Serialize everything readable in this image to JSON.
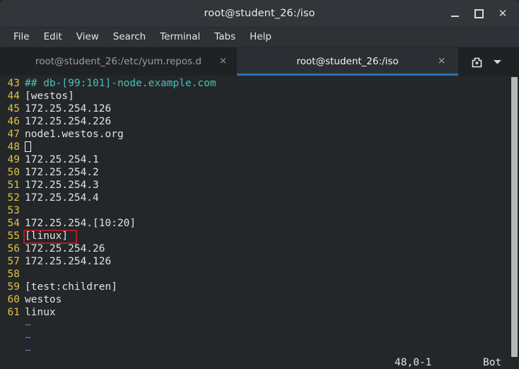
{
  "window": {
    "title": "root@student_26:/iso",
    "controls": {
      "minimize": "minimize-icon",
      "maximize": "maximize-icon",
      "close": "✕"
    }
  },
  "menubar": {
    "items": [
      {
        "label": "File"
      },
      {
        "label": "Edit"
      },
      {
        "label": "View"
      },
      {
        "label": "Search"
      },
      {
        "label": "Terminal"
      },
      {
        "label": "Tabs"
      },
      {
        "label": "Help"
      }
    ]
  },
  "tabs": {
    "items": [
      {
        "label": "root@student_26:/etc/yum.repos.d",
        "close": "✕",
        "active": false
      },
      {
        "label": "root@student_26:/iso",
        "close": "✕",
        "active": true
      }
    ],
    "new_tab_icon": "new-tab-icon",
    "tab_menu_icon": "chevron-down-icon",
    "active_indicator_color": "#2a70b8"
  },
  "editor": {
    "lines": [
      {
        "no": "43",
        "text": "## db-[99:101]-node.example.com",
        "style": "comment"
      },
      {
        "no": "44",
        "text": "[westos]",
        "style": "normal"
      },
      {
        "no": "45",
        "text": "172.25.254.126",
        "style": "normal"
      },
      {
        "no": "46",
        "text": "172.25.254.226",
        "style": "normal"
      },
      {
        "no": "47",
        "text": "node1.westos.org",
        "style": "normal"
      },
      {
        "no": "48",
        "text": "",
        "style": "cursor"
      },
      {
        "no": "49",
        "text": "172.25.254.1",
        "style": "normal"
      },
      {
        "no": "50",
        "text": "172.25.254.2",
        "style": "normal"
      },
      {
        "no": "51",
        "text": "172.25.254.3",
        "style": "normal"
      },
      {
        "no": "52",
        "text": "172.25.254.4",
        "style": "normal"
      },
      {
        "no": "53",
        "text": "",
        "style": "normal"
      },
      {
        "no": "54",
        "text": "172.25.254.[10:20]",
        "style": "normal"
      },
      {
        "no": "55",
        "text": "[linux]",
        "style": "normal"
      },
      {
        "no": "56",
        "text": "172.25.254.26",
        "style": "normal"
      },
      {
        "no": "57",
        "text": "172.25.254.126",
        "style": "normal"
      },
      {
        "no": "58",
        "text": "",
        "style": "normal"
      },
      {
        "no": "59",
        "text": "[test:children]",
        "style": "normal"
      },
      {
        "no": "60",
        "text": "westos",
        "style": "normal"
      },
      {
        "no": "61",
        "text": "linux",
        "style": "normal"
      }
    ],
    "empty_markers": [
      "~",
      "~",
      "~"
    ],
    "highlight": {
      "target_line": "55",
      "color": "#b01b24"
    },
    "status": {
      "position": "48,0-1",
      "state": "Bot"
    },
    "colors": {
      "background": "#232729",
      "foreground": "#dfe3e4",
      "line_number": "#e2c044",
      "comment": "#49c1b5",
      "tilde": "#5c87c4"
    }
  }
}
